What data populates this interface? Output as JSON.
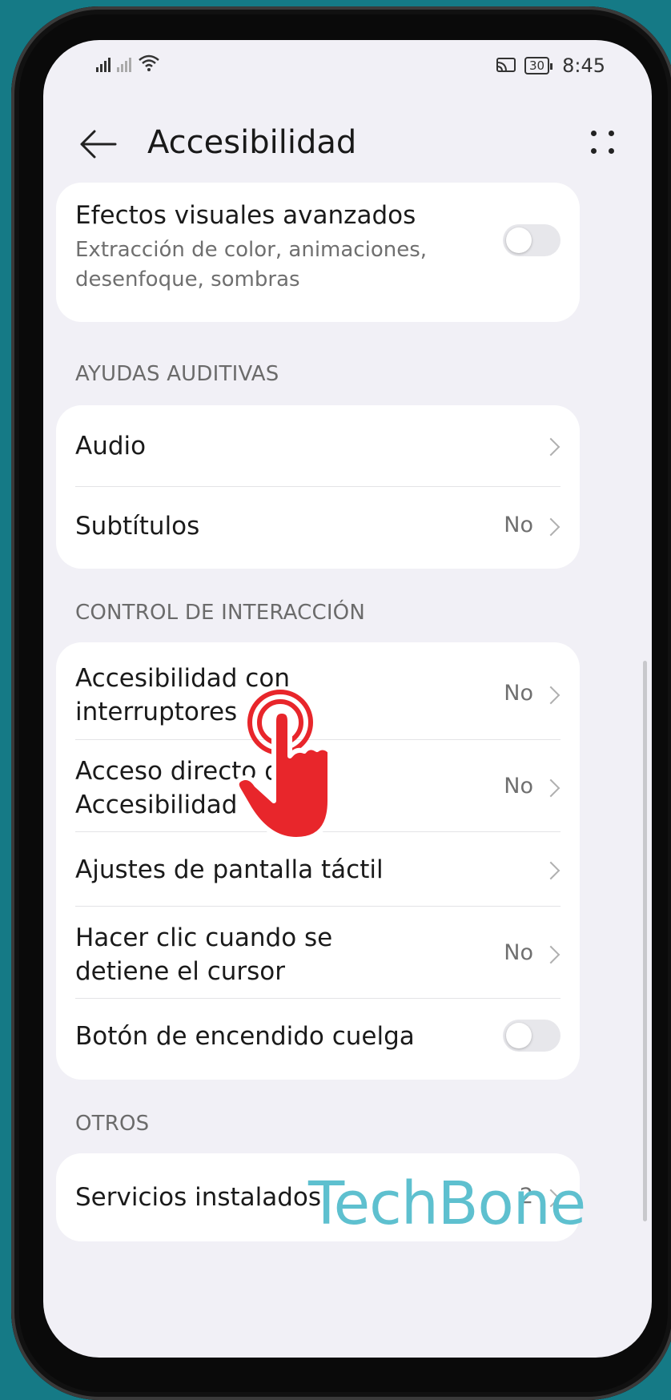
{
  "status_bar": {
    "time": "8:45",
    "battery": "30"
  },
  "header": {
    "title": "Accesibilidad"
  },
  "card_visual": {
    "label": "Efectos visuales avanzados",
    "sub": "Extracción de color, animaciones, desenfoque, sombras",
    "toggle_on": false
  },
  "section_auditivas": "AYUDAS AUDITIVAS",
  "auditivas": [
    {
      "label": "Audio",
      "value": ""
    },
    {
      "label": "Subtítulos",
      "value": "No"
    }
  ],
  "section_interaccion": "CONTROL DE INTERACCIÓN",
  "interaccion": [
    {
      "label": "Accesibilidad con interruptores",
      "value": "No"
    },
    {
      "label": "Acceso directo de Accesibilidad",
      "value": "No"
    },
    {
      "label": "Ajustes de pantalla táctil",
      "value": ""
    },
    {
      "label": "Hacer clic cuando se detiene el cursor",
      "value": "No"
    },
    {
      "label": "Botón de encendido cuelga",
      "toggle_on": false
    }
  ],
  "section_otros": "OTROS",
  "otros": [
    {
      "label": "Servicios instalados",
      "value": "2"
    }
  ],
  "watermark": "TechBone",
  "colors": {
    "background": "#157a86",
    "screen": "#f1f0f6",
    "accent_hand": "#e8262b"
  }
}
